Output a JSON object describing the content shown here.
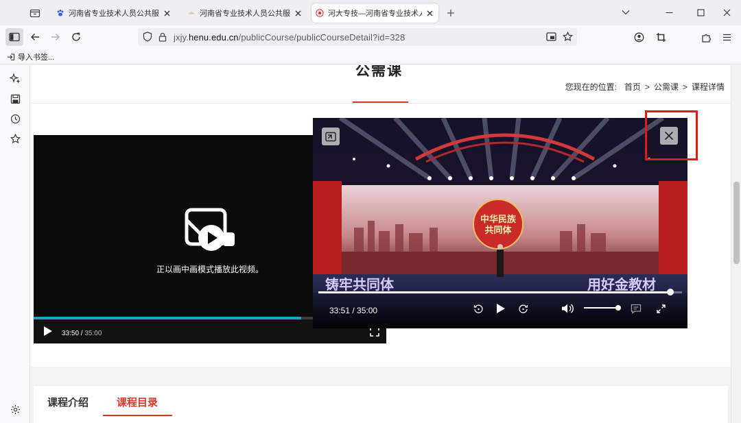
{
  "browser": {
    "tabs": [
      {
        "title": "河南省专业技术人员公共服务平台",
        "active": false
      },
      {
        "title": "河南省专业技术人员公共服务平台",
        "active": false
      },
      {
        "title": "河大专技—河南省专业技术人员",
        "active": true
      }
    ],
    "url_prefix": "jxjy.",
    "url_domain": "henu.edu.cn",
    "url_path": "/publicCourse/publicCourseDetail?id=328",
    "bookmark_label": "导入书签..."
  },
  "page": {
    "section_title": "公需课",
    "breadcrumb": {
      "prefix": "您现在的位置:",
      "items": [
        "首页",
        "公需课",
        "课程详情"
      ],
      "separator": ">"
    },
    "player": {
      "pip_message": "正以画中画模式播放此视频。",
      "current_time": "33:50",
      "duration": "35:00",
      "progress": 0.9667
    },
    "course_tabs": [
      {
        "label": "课程介绍",
        "active": false
      },
      {
        "label": "课程目录",
        "active": true
      }
    ]
  },
  "pip_window": {
    "time_text": "33:51 / 35:00",
    "progress": 0.9671,
    "volume": 0.95,
    "video_banner_left": "铸牢共同体",
    "video_banner_right": "用好金教材",
    "video_center_text": "中华民族共同体"
  },
  "colors": {
    "accent_red": "#d9372b",
    "progress_blue": "#1aa3c7",
    "highlight_red": "#e21a1a"
  },
  "icons": {
    "tab_favicons": [
      "paw-icon",
      "ticket-icon",
      "emblem-icon"
    ],
    "sidebar": [
      "ai-sparkle-icon",
      "page-save-icon",
      "history-icon",
      "bookmark-star-icon",
      "settings-gear-icon"
    ],
    "pip": [
      "restore-tab-icon",
      "close-icon",
      "replay-10-icon",
      "play-icon",
      "forward-10-icon",
      "volume-icon",
      "captions-icon",
      "fullscreen-icon"
    ]
  }
}
